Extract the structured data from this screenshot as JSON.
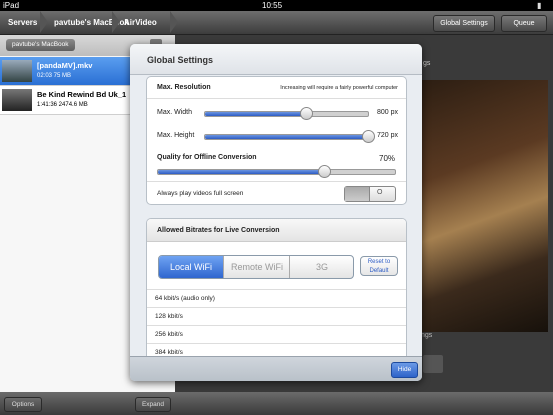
{
  "status": {
    "device": "iPad",
    "time": "10:55",
    "battery": "▮"
  },
  "nav": {
    "crumbs": [
      "Servers",
      "pavtube's MacBook",
      "AirVideo"
    ],
    "global_settings": "Global Settings",
    "queue": "Queue"
  },
  "sidebar": {
    "header": "pavtube's MacBook",
    "items": [
      {
        "title": "[pandaMV].mkv",
        "meta": "02:03  75 MB"
      },
      {
        "title": "Be Kind Rewind Bd Uk_1",
        "meta": "1:41:36  2474.6 MB"
      }
    ]
  },
  "bottom": {
    "options": "Options",
    "expand": "Expand"
  },
  "poster": {
    "label": "ngs",
    "panel_title": "gs"
  },
  "modal": {
    "title": "Global Settings",
    "resolution": {
      "label": "Max. Resolution",
      "note": "Increasing will require a fairly powerful computer",
      "width_label": "Max. Width",
      "width_value": "800 px",
      "width_level": 0.62,
      "height_label": "Max. Height",
      "height_value": "720 px",
      "height_level": 1.0,
      "quality_label": "Quality for Offline Conversion",
      "quality_value": "70%",
      "quality_level": 0.7,
      "fullscreen_label": "Always play videos full screen",
      "toggle_on_label": "",
      "toggle_off_label": "O"
    },
    "bitrates": {
      "label": "Allowed Bitrates for Live Conversion",
      "segments": [
        "Local WiFi",
        "Remote WiFi",
        "3G"
      ],
      "reset": "Reset to Default",
      "list": [
        "64 kbit/s (audio only)",
        "128 kbit/s",
        "256 kbit/s",
        "384 kbit/s"
      ]
    },
    "hide": "Hide"
  },
  "colors": {
    "accent": "#3a6fd8",
    "selected_row": "#3f8be6"
  }
}
